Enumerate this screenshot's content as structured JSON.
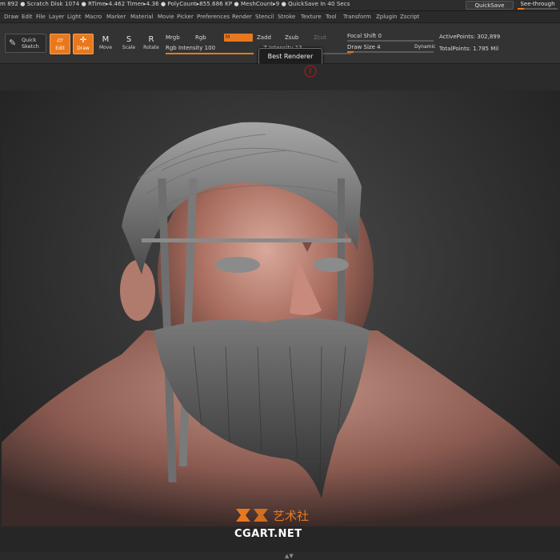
{
  "status_bar": {
    "text": "m 892  ● Scratch Disk 1074  ●  RTime▸4.462 Timer▸4.36  ●  PolyCount▸855.686 KP  ●  MeshCount▸9  ● QuickSave In 40 Secs",
    "quicksave": "QuickSave",
    "see_through": "See-through",
    "see_through_level": 0.15
  },
  "menu": [
    "Draw",
    "Edit",
    "File",
    "Layer",
    "Light",
    "Macro",
    "Marker",
    "Material",
    "Movie",
    "Picker",
    "Preferences",
    "Render",
    "Stencil",
    "Stroke",
    "Texture",
    "Tool",
    "Transform",
    "Zplugin",
    "Zscript"
  ],
  "toolbar": {
    "quick_sketch": "Quick Sketch",
    "edit": "Edit",
    "draw": "Draw",
    "move": "Move",
    "scale": "Scale",
    "rotate": "Rotate",
    "mrgb": "Mrgb",
    "rgb": "Rgb",
    "m": "M",
    "zadd": "Zadd",
    "zsub": "Zsub",
    "zcut": "Zcut",
    "rgb_intensity": "Rgb Intensity 100",
    "z_intensity": "Z Intensity 13",
    "focal_shift": "Focal Shift 0",
    "draw_size": "Draw Size 4",
    "dynamic": "Dynamic",
    "active_points": "ActivePoints: 302,899",
    "total_points": "TotalPoints: 1.785 Mil",
    "tooltip": "Best Renderer"
  },
  "watermark": {
    "cn_text": "艺术社",
    "domain": "CGART.NET"
  },
  "colors": {
    "accent": "#e8781e",
    "background": "#262626"
  }
}
